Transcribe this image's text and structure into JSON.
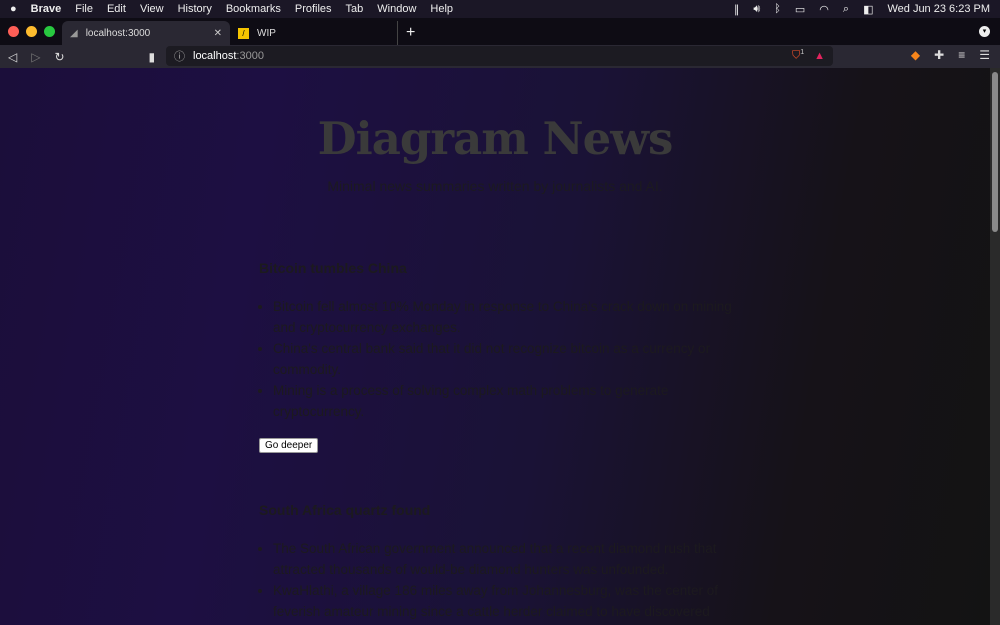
{
  "menubar": {
    "apple": "",
    "app": "Brave",
    "items": [
      "File",
      "Edit",
      "View",
      "History",
      "Bookmarks",
      "Profiles",
      "Tab",
      "Window",
      "Help"
    ],
    "datetime": "Wed Jun 23  6:23 PM"
  },
  "tabs": [
    {
      "label": "localhost:3000"
    },
    {
      "label": "WIP"
    }
  ],
  "address": {
    "host": "localhost",
    "port": ":3000",
    "shield_count": "1"
  },
  "page": {
    "title": "Diagram News",
    "subtitle": "Minimal news summaries written by journalists and AI.",
    "articles": [
      {
        "heading": "Bitcoin tumbles China",
        "bullets": [
          "Bitcoin fell almost 10% Monday in response to China's crack down on mining and cryptocurrency exchanges.",
          "China's central bank said that it did not recognize bitcoin as a currency or commodity.",
          "Mining is a process of solving complex math problems to generate cryptocurrency."
        ],
        "button": "Go deeper"
      },
      {
        "heading": "South Africa quartz found",
        "bullets": [
          "The South African government announced that a recent diamond rush that attracted thousands of would-be diamond hunters was unfounded.",
          "KwaHlathi, a village 186 miles away from Johannesburg, was the center of feverish amateur mining since a cattle herder claimed to have discovered"
        ]
      }
    ]
  }
}
